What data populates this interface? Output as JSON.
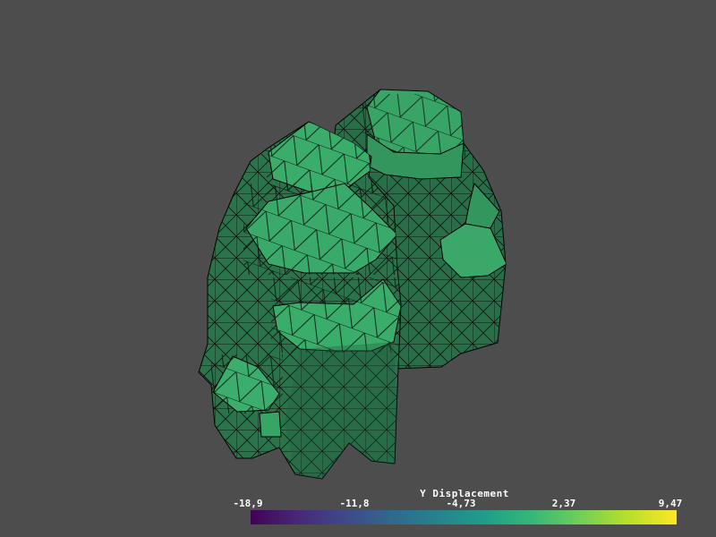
{
  "scene": {
    "background": "#4d4d4d",
    "surface_color": "#2e8b57",
    "edge_color": "#000000"
  },
  "colorbar": {
    "title": "Y Displacement",
    "colormap": "viridis",
    "min": -18.9,
    "max": 9.47,
    "tick_labels": [
      "-18,9",
      "-11,8",
      "-4,73",
      "2,37",
      "9,47"
    ]
  }
}
